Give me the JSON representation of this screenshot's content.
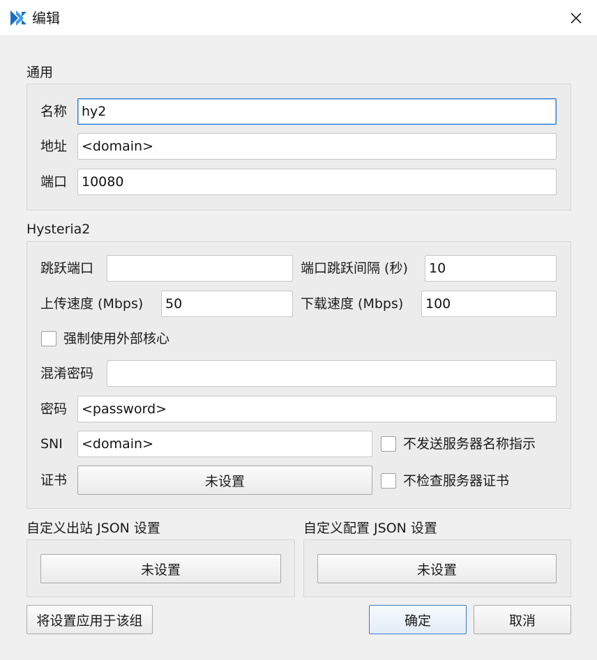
{
  "window": {
    "title": "编辑",
    "accent": "#1b6ec2"
  },
  "general": {
    "section": "通用",
    "name_label": "名称",
    "name_value": "hy2",
    "address_label": "地址",
    "address_value": "<domain>",
    "port_label": "端口",
    "port_value": "10080"
  },
  "hysteria2": {
    "section": "Hysteria2",
    "hop_port_label": "跳跃端口",
    "hop_port_value": "",
    "hop_interval_label": "端口跳跃间隔 (秒)",
    "hop_interval_value": "10",
    "upload_label": "上传速度 (Mbps)",
    "upload_value": "50",
    "download_label": "下载速度 (Mbps)",
    "download_value": "100",
    "force_external_core_label": "强制使用外部核心",
    "force_external_core_checked": false,
    "obfs_password_label": "混淆密码",
    "obfs_password_value": "",
    "password_label": "密码",
    "password_value": "<password>",
    "sni_label": "SNI",
    "sni_value": "<domain>",
    "no_sni_label": "不发送服务器名称指示",
    "no_sni_checked": false,
    "cert_label": "证书",
    "cert_button": "未设置",
    "skip_cert_check_label": "不检查服务器证书",
    "skip_cert_check_checked": false
  },
  "custom_outbound": {
    "section": "自定义出站 JSON 设置",
    "button": "未设置"
  },
  "custom_config": {
    "section": "自定义配置 JSON 设置",
    "button": "未设置"
  },
  "footer": {
    "apply_group": "将设置应用于该组",
    "ok": "确定",
    "cancel": "取消"
  }
}
